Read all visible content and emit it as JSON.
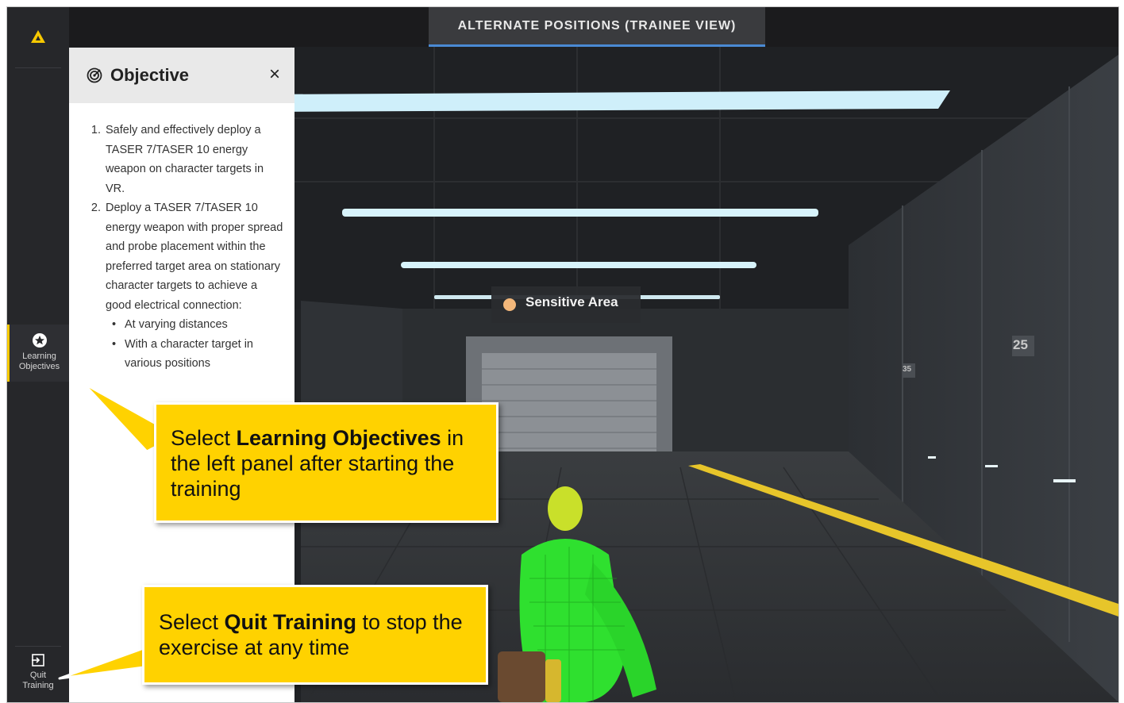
{
  "rail": {
    "logo_icon": "logo-triangle-icon",
    "items": [
      {
        "label_line1": "Learning",
        "label_line2": "Objectives",
        "icon": "star-badge-icon"
      },
      {
        "label_line1": "Quit",
        "label_line2": "Training",
        "icon": "exit-icon"
      }
    ]
  },
  "header": {
    "view_tab": "ALTERNATE POSITIONS (TRAINEE VIEW)"
  },
  "panel": {
    "icon": "target-icon",
    "title": "Objective",
    "close_label": "×",
    "objectives": [
      "Safely and effectively deploy a TASER 7/TASER 10 energy weapon on character targets in VR.",
      "Deploy a TASER 7/TASER 10 energy weapon with proper spread and probe placement within the preferred target area on stationary character targets to achieve a good electrical connection:"
    ],
    "sub_points": [
      "At varying distances",
      "With a character target in various positions"
    ]
  },
  "scene": {
    "sign_text": "Sensitive Area",
    "sign_dot_color": "#f2b77a",
    "distance_marker_near": "25",
    "distance_marker_far": "35"
  },
  "callouts": {
    "objectives": {
      "prefix": "Select ",
      "bold": "Learning Objectives",
      "suffix": " in the left panel after starting the training"
    },
    "quit": {
      "prefix": "Select ",
      "bold": "Quit Training",
      "suffix": " to stop the exercise at any time"
    }
  },
  "colors": {
    "accent": "#ffd200",
    "tab_underline": "#4a8ad4",
    "rail": "#26272a"
  }
}
